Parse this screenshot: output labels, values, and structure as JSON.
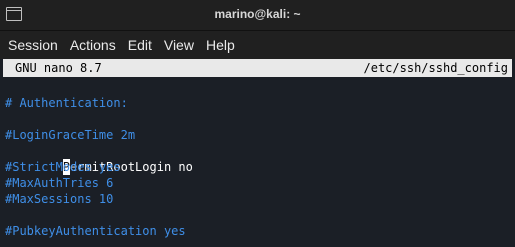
{
  "window": {
    "title": "marino@kali: ~",
    "app_icon": "terminal-icon"
  },
  "menubar": [
    "Session",
    "Actions",
    "Edit",
    "View",
    "Help"
  ],
  "nano": {
    "version": "GNU nano 8.7",
    "file": "/etc/ssh/sshd_config"
  },
  "lines": [
    "",
    "# Authentication:",
    "",
    "#LoginGraceTime 2m",
    "PermitRootLogin no",
    "#StrictModes yes",
    "#MaxAuthTries 6",
    "#MaxSessions 10",
    "",
    "#PubkeyAuthentication yes"
  ],
  "cursor": {
    "line_index": 4,
    "char": "P"
  }
}
